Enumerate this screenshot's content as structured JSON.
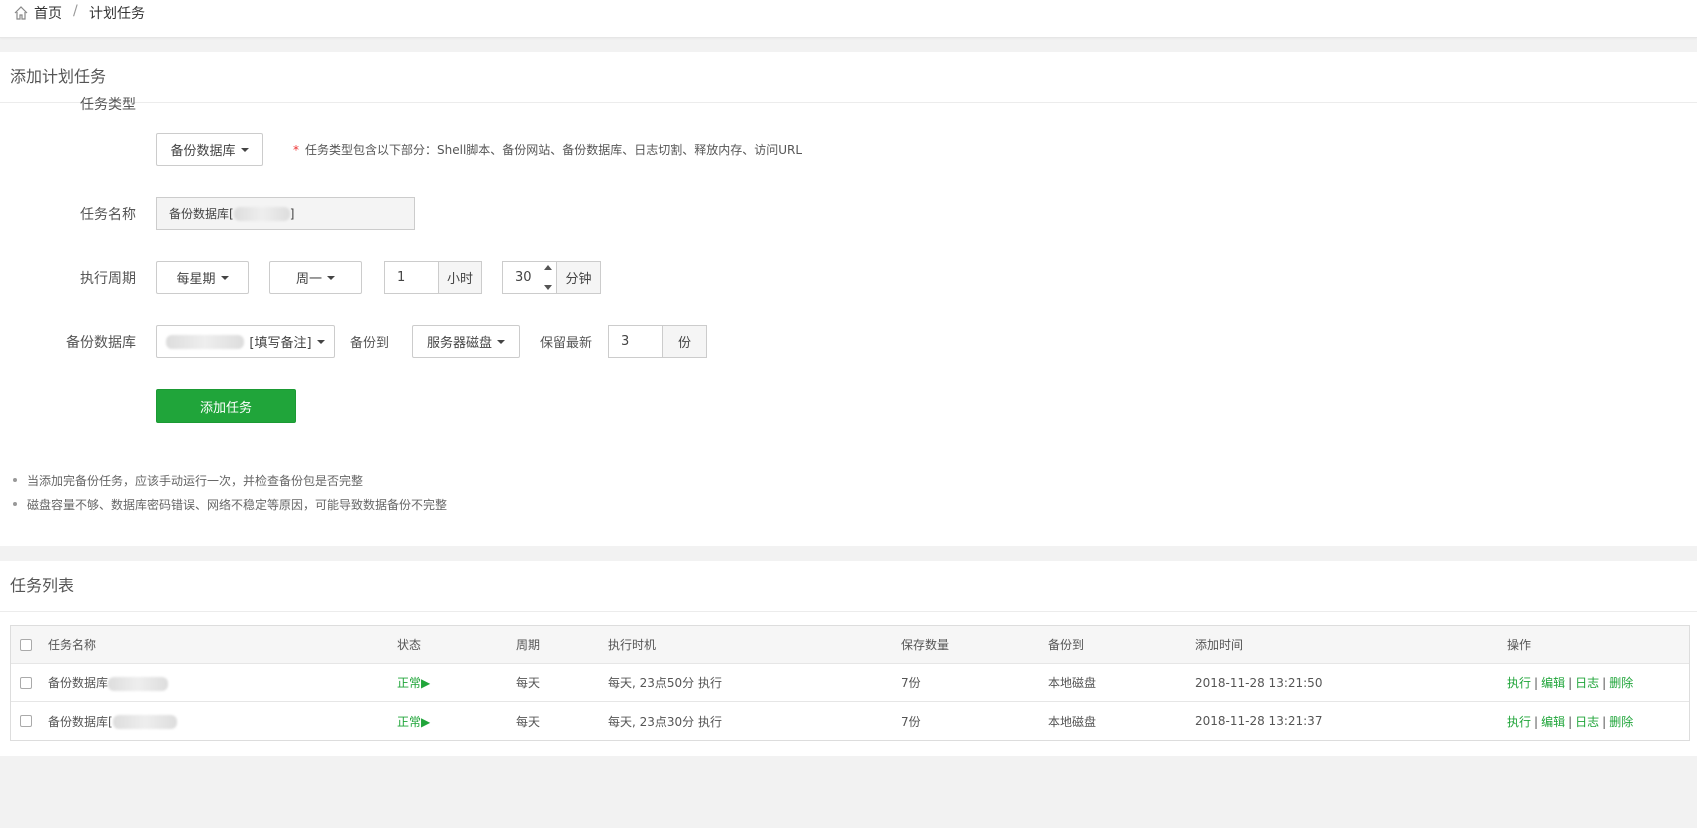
{
  "breadcrumb": {
    "home": "首页",
    "separator": "/",
    "current": "计划任务"
  },
  "add_panel": {
    "title": "添加计划任务",
    "task_type_label": "任务类型",
    "task_type_value": "备份数据库",
    "task_type_hint_star": "*",
    "task_type_hint": "任务类型包含以下部分：Shell脚本、备份网站、备份数据库、日志切割、释放内存、访问URL",
    "task_name_label": "任务名称",
    "task_name_value": "备份数据库[",
    "task_name_suffix": "]",
    "cycle_label": "执行周期",
    "cycle_value": "每星期",
    "weekday_value": "周一",
    "hour_value": "1",
    "hour_unit": "小时",
    "minute_value": "30",
    "minute_unit": "分钟",
    "db_label": "备份数据库",
    "db_value_suffix": "[填写备注]",
    "backup_to_label": "备份到",
    "backup_to_value": "服务器磁盘",
    "keep_label": "保留最新",
    "keep_value": "3",
    "keep_unit": "份",
    "submit_label": "添加任务",
    "notes": [
      "当添加完备份任务，应该手动运行一次，并检查备份包是否完整",
      "磁盘容量不够、数据库密码错误、网络不稳定等原因，可能导致数据备份不完整"
    ]
  },
  "list_panel": {
    "title": "任务列表",
    "columns": [
      "任务名称",
      "状态",
      "周期",
      "执行时机",
      "保存数量",
      "备份到",
      "添加时间",
      "操作"
    ],
    "rows": [
      {
        "name": "备份数据库",
        "status": "正常▶",
        "cycle": "每天",
        "timing": "每天, 23点50分 执行",
        "keep": "7份",
        "backup_to": "本地磁盘",
        "added": "2018-11-28 13:21:50"
      },
      {
        "name": "备份数据库[",
        "status": "正常▶",
        "cycle": "每天",
        "timing": "每天, 23点30分 执行",
        "keep": "7份",
        "backup_to": "本地磁盘",
        "added": "2018-11-28 13:21:37"
      }
    ],
    "ops": {
      "run": "执行",
      "edit": "编辑",
      "log": "日志",
      "delete": "删除",
      "sep": "|"
    }
  },
  "colors": {
    "primary": "#20a53a",
    "required": "#e33333"
  },
  "icons": {
    "home": "home-icon",
    "caret": "caret-down-icon"
  }
}
